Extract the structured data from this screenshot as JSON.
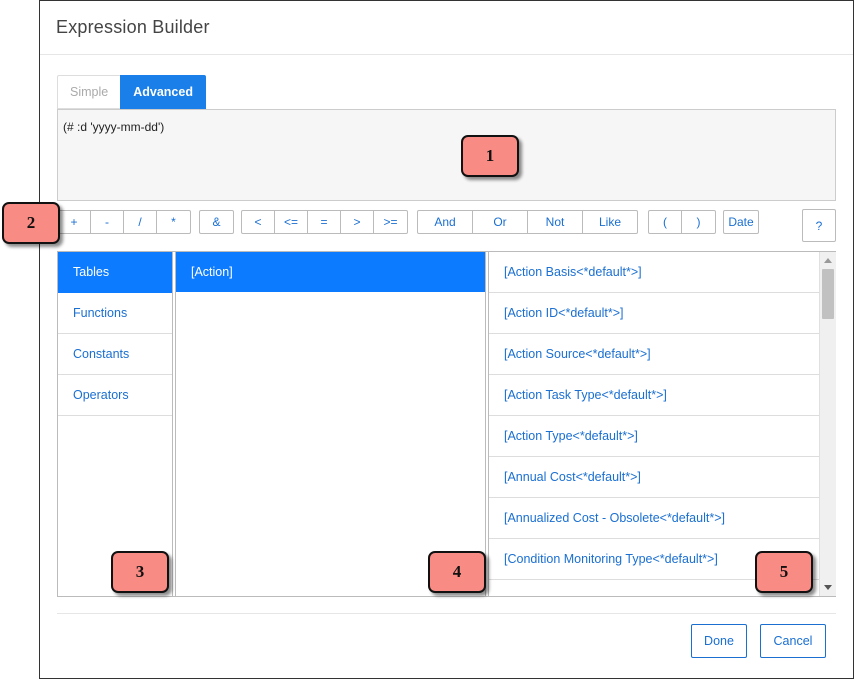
{
  "dialog": {
    "title": "Expression Builder"
  },
  "tabs": [
    {
      "label": "Simple",
      "active": false
    },
    {
      "label": "Advanced",
      "active": true
    }
  ],
  "expression": {
    "value": "(# :d 'yyyy-mm-dd')"
  },
  "operators": {
    "arith": [
      "+",
      "-",
      "/",
      "*"
    ],
    "concat": [
      "&"
    ],
    "compare": [
      "<",
      "<=",
      "=",
      ">",
      ">="
    ],
    "logic": [
      "And",
      "Or",
      "Not",
      "Like"
    ],
    "parens": [
      "(",
      ")"
    ],
    "date": [
      "Date"
    ],
    "help": "?"
  },
  "categories": [
    {
      "label": "Tables",
      "selected": true
    },
    {
      "label": "Functions",
      "selected": false
    },
    {
      "label": "Constants",
      "selected": false
    },
    {
      "label": "Operators",
      "selected": false
    }
  ],
  "tables": [
    {
      "label": "[Action]",
      "selected": true
    }
  ],
  "fields": [
    "[Action Basis<*default*>]",
    "[Action ID<*default*>]",
    "[Action Source<*default*>]",
    "[Action Task Type<*default*>]",
    "[Action Type<*default*>]",
    "[Annual Cost<*default*>]",
    "[Annualized Cost - Obsolete<*default*>]",
    "[Condition Monitoring Type<*default*>]"
  ],
  "footer": {
    "done": "Done",
    "cancel": "Cancel"
  },
  "callouts": [
    "1",
    "2",
    "3",
    "4",
    "5"
  ],
  "colors": {
    "accent": "#1a7fe8",
    "selected": "#0d7bff",
    "callout": "#f98b85"
  },
  "icons": {
    "scroll_up": "triangle-up-icon",
    "scroll_down": "triangle-down-icon"
  }
}
